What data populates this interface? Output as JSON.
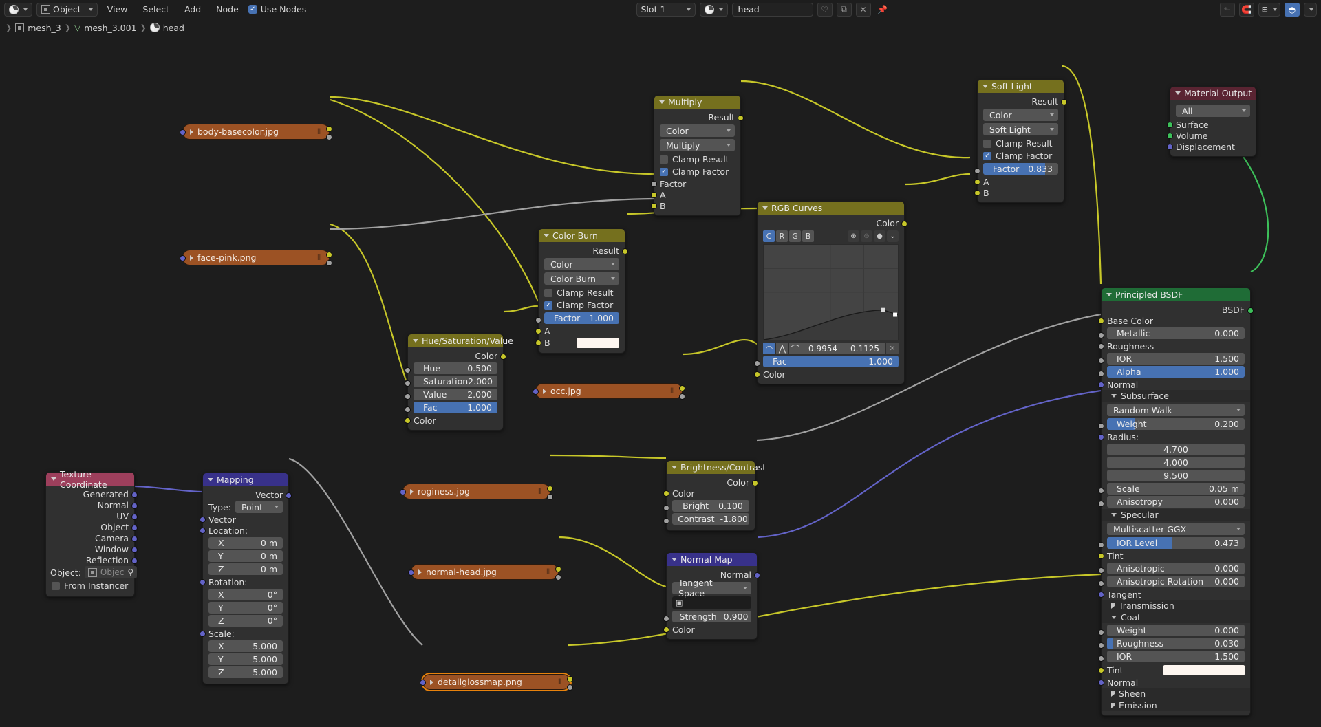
{
  "header": {
    "editor_type": "shader-editor",
    "mode": "Object",
    "menus": [
      "View",
      "Select",
      "Add",
      "Node"
    ],
    "use_nodes_label": "Use Nodes",
    "use_nodes_checked": true,
    "slot": "Slot 1",
    "material": "head",
    "right_icons": [
      "snap-magnet-icon",
      "snap-target-icon",
      "proportional-edit-icon"
    ]
  },
  "breadcrumb": {
    "items": [
      {
        "label": "mesh_3",
        "icon": "object-icon"
      },
      {
        "label": "mesh_3.001",
        "icon": "mesh-data-icon"
      },
      {
        "label": "head",
        "icon": "material-icon"
      }
    ]
  },
  "nodes": {
    "body_basecolor": {
      "title": "body-basecolor.jpg"
    },
    "face_pink": {
      "title": "face-pink.png"
    },
    "occ": {
      "title": "occ.jpg"
    },
    "roginess": {
      "title": "roginess.jpg"
    },
    "normal_head": {
      "title": "normal-head.jpg"
    },
    "detailglossmap": {
      "title": "detailglossmap.png"
    },
    "multiply": {
      "title": "Multiply",
      "output": "Result",
      "data_type": "Color",
      "blend_mode": "Multiply",
      "clamp_result_label": "Clamp Result",
      "clamp_result": false,
      "clamp_factor_label": "Clamp Factor",
      "clamp_factor": true,
      "inputs": [
        "Factor",
        "A",
        "B"
      ]
    },
    "color_burn": {
      "title": "Color Burn",
      "output": "Result",
      "data_type": "Color",
      "blend_mode": "Color Burn",
      "clamp_result_label": "Clamp Result",
      "clamp_result": false,
      "clamp_factor_label": "Clamp Factor",
      "clamp_factor": true,
      "factor_label": "Factor",
      "factor_value": "1.000",
      "inputs": [
        "A",
        "B"
      ]
    },
    "soft_light": {
      "title": "Soft Light",
      "output": "Result",
      "data_type": "Color",
      "blend_mode": "Soft Light",
      "clamp_result_label": "Clamp Result",
      "clamp_result": false,
      "clamp_factor_label": "Clamp Factor",
      "clamp_factor": true,
      "factor_label": "Factor",
      "factor_value": "0.833",
      "factor_pct": 83,
      "inputs": [
        "A",
        "B"
      ]
    },
    "hsv": {
      "title": "Hue/Saturation/Value",
      "output": "Color",
      "fields": [
        {
          "label": "Hue",
          "value": "0.500",
          "blue": false
        },
        {
          "label": "Saturation",
          "value": "2.000",
          "blue": false
        },
        {
          "label": "Value",
          "value": "2.000",
          "blue": false
        },
        {
          "label": "Fac",
          "value": "1.000",
          "blue": true
        }
      ],
      "input": "Color"
    },
    "rgb_curves": {
      "title": "RGB Curves",
      "output": "Color",
      "channels": [
        "C",
        "R",
        "G",
        "B"
      ],
      "active_channel": "C",
      "coord_x": "0.9954",
      "coord_y": "0.1125",
      "fac_label": "Fac",
      "fac_value": "1.000",
      "input": "Color"
    },
    "brightness_contrast": {
      "title": "Brightness/Contrast",
      "output": "Color",
      "input": "Color",
      "fields": [
        {
          "label": "Bright",
          "value": "0.100"
        },
        {
          "label": "Contrast",
          "value": "-1.800"
        }
      ]
    },
    "normal_map": {
      "title": "Normal Map",
      "output": "Normal",
      "space": "Tangent Space",
      "uv_map": "",
      "strength_label": "Strength",
      "strength_value": "0.900",
      "input": "Color"
    },
    "texture_coordinate": {
      "title": "Texture Coordinate",
      "outputs": [
        "Generated",
        "Normal",
        "UV",
        "Object",
        "Camera",
        "Window",
        "Reflection"
      ],
      "object_label": "Object:",
      "object_value": "Objec",
      "from_instancer_label": "From Instancer",
      "from_instancer": false
    },
    "mapping": {
      "title": "Mapping",
      "output": "Vector",
      "type_label": "Type:",
      "type_value": "Point",
      "vector_label": "Vector",
      "location_label": "Location:",
      "location": [
        {
          "axis": "X",
          "value": "0 m"
        },
        {
          "axis": "Y",
          "value": "0 m"
        },
        {
          "axis": "Z",
          "value": "0 m"
        }
      ],
      "rotation_label": "Rotation:",
      "rotation": [
        {
          "axis": "X",
          "value": "0°"
        },
        {
          "axis": "Y",
          "value": "0°"
        },
        {
          "axis": "Z",
          "value": "0°"
        }
      ],
      "scale_label": "Scale:",
      "scale": [
        {
          "axis": "X",
          "value": "5.000"
        },
        {
          "axis": "Y",
          "value": "5.000"
        },
        {
          "axis": "Z",
          "value": "5.000"
        }
      ]
    },
    "principled": {
      "title": "Principled BSDF",
      "output": "BSDF",
      "base_color_label": "Base Color",
      "metallic": {
        "label": "Metallic",
        "value": "0.000"
      },
      "roughness_label": "Roughness",
      "ior": {
        "label": "IOR",
        "value": "1.500"
      },
      "alpha": {
        "label": "Alpha",
        "value": "1.000",
        "blue": true
      },
      "normal_label": "Normal",
      "subsurface_panel": "Subsurface",
      "subsurface_method": "Random Walk",
      "sss_weight": {
        "label": "Weight",
        "value": "0.200",
        "pct": 20
      },
      "radius_label": "Radius:",
      "radius": [
        "4.700",
        "4.000",
        "9.500"
      ],
      "scale": {
        "label": "Scale",
        "value": "0.05 m"
      },
      "anisotropy": {
        "label": "Anisotropy",
        "value": "0.000"
      },
      "specular_panel": "Specular",
      "specular_dist": "Multiscatter GGX",
      "ior_level": {
        "label": "IOR Level",
        "value": "0.473",
        "pct": 47
      },
      "tint_label": "Tint",
      "anisotropic": {
        "label": "Anisotropic",
        "value": "0.000"
      },
      "anisotropic_rotation": {
        "label": "Anisotropic Rotation",
        "value": "0.000"
      },
      "tangent_label": "Tangent",
      "transmission_panel": "Transmission",
      "coat_panel": "Coat",
      "coat_weight": {
        "label": "Weight",
        "value": "0.000"
      },
      "coat_roughness": {
        "label": "Roughness",
        "value": "0.030",
        "pct": 3
      },
      "coat_ior": {
        "label": "IOR",
        "value": "1.500"
      },
      "coat_tint_label": "Tint",
      "coat_normal_label": "Normal",
      "sheen_panel": "Sheen",
      "emission_panel": "Emission"
    },
    "material_output": {
      "title": "Material Output",
      "target": "All",
      "inputs": [
        "Surface",
        "Volume",
        "Displacement"
      ]
    }
  },
  "colors": {
    "accent_blue": "#4772b3",
    "wire_yellow": "#c7c729",
    "wire_grey": "#a1a1a1",
    "wire_purple": "#6363c7",
    "wire_green": "#3dc05a",
    "header_mix": "#75701e",
    "header_bsdf": "#1f6c36",
    "header_output": "#5a2432",
    "header_vector": "#38318a",
    "header_input": "#9d3f5c",
    "header_texture": "#9c5224"
  }
}
